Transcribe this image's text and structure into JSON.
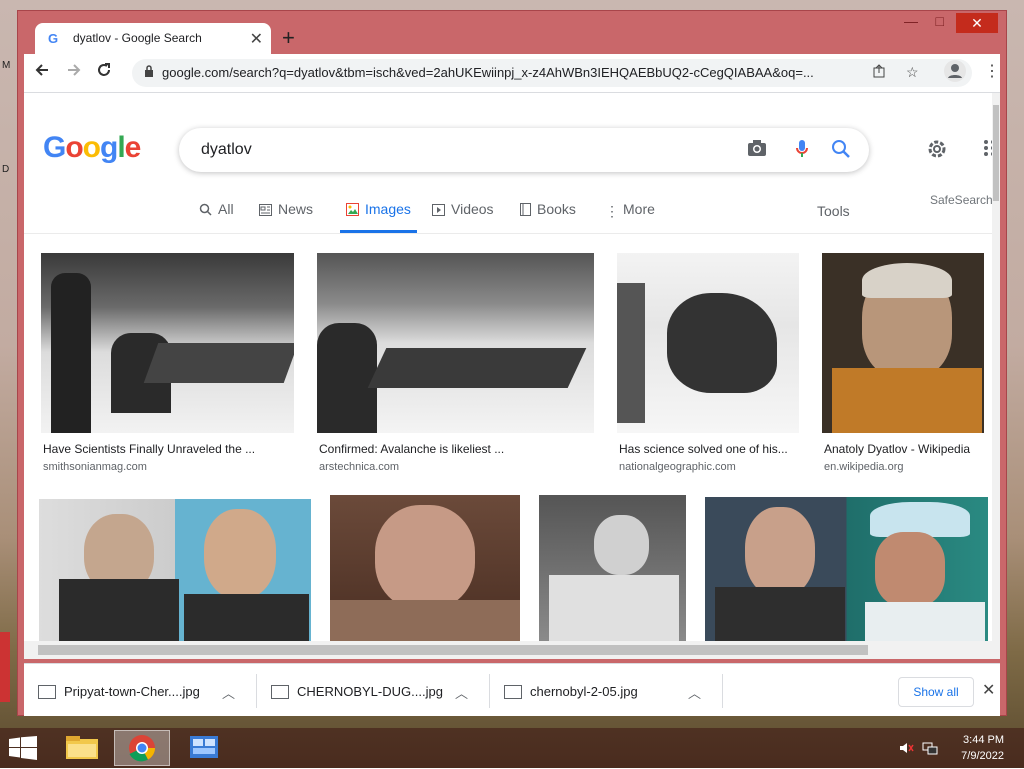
{
  "browser": {
    "tab_title": "dyatlov - Google Search",
    "url": "google.com/search?q=dyatlov&tbm=isch&ved=2ahUKEwiinpj_x-z4AhWBn3IEHQAEBbUQ2-cCegQIABAA&oq=...",
    "window_controls": {
      "minimize": "—",
      "maximize": "□",
      "close": "✕"
    }
  },
  "colors": {
    "google_blue": "#4285F4",
    "google_red": "#EA4335",
    "google_yellow": "#FBBC05",
    "google_green": "#34A853",
    "accent": "#1a73e8"
  },
  "search": {
    "logo": [
      "G",
      "o",
      "o",
      "g",
      "l",
      "e"
    ],
    "query": "dyatlov",
    "tabs": [
      {
        "label": "All",
        "icon": "search-icon"
      },
      {
        "label": "News",
        "icon": "news-icon"
      },
      {
        "label": "Images",
        "icon": "image-icon",
        "active": true
      },
      {
        "label": "Videos",
        "icon": "play-icon"
      },
      {
        "label": "Books",
        "icon": "book-icon"
      },
      {
        "label": "More",
        "icon": "more-vert-icon"
      }
    ],
    "tools": "Tools",
    "safesearch": "SafeSearch"
  },
  "results": [
    {
      "caption": "Have Scientists Finally Unraveled the ...",
      "source": "smithsonianmag.com"
    },
    {
      "caption": "Confirmed: Avalanche is likeliest ...",
      "source": "arstechnica.com"
    },
    {
      "caption": "Has science solved one of his...",
      "source": "nationalgeographic.com"
    },
    {
      "caption": "Anatoly Dyatlov - Wikipedia",
      "source": "en.wikipedia.org"
    }
  ],
  "downloads": {
    "items": [
      {
        "name": "Pripyat-town-Cher....jpg"
      },
      {
        "name": "CHERNOBYL-DUG....jpg"
      },
      {
        "name": "chernobyl-2-05.jpg"
      }
    ],
    "show_all": "Show all"
  },
  "taskbar": {
    "time": "3:44 PM",
    "date": "7/9/2022"
  }
}
